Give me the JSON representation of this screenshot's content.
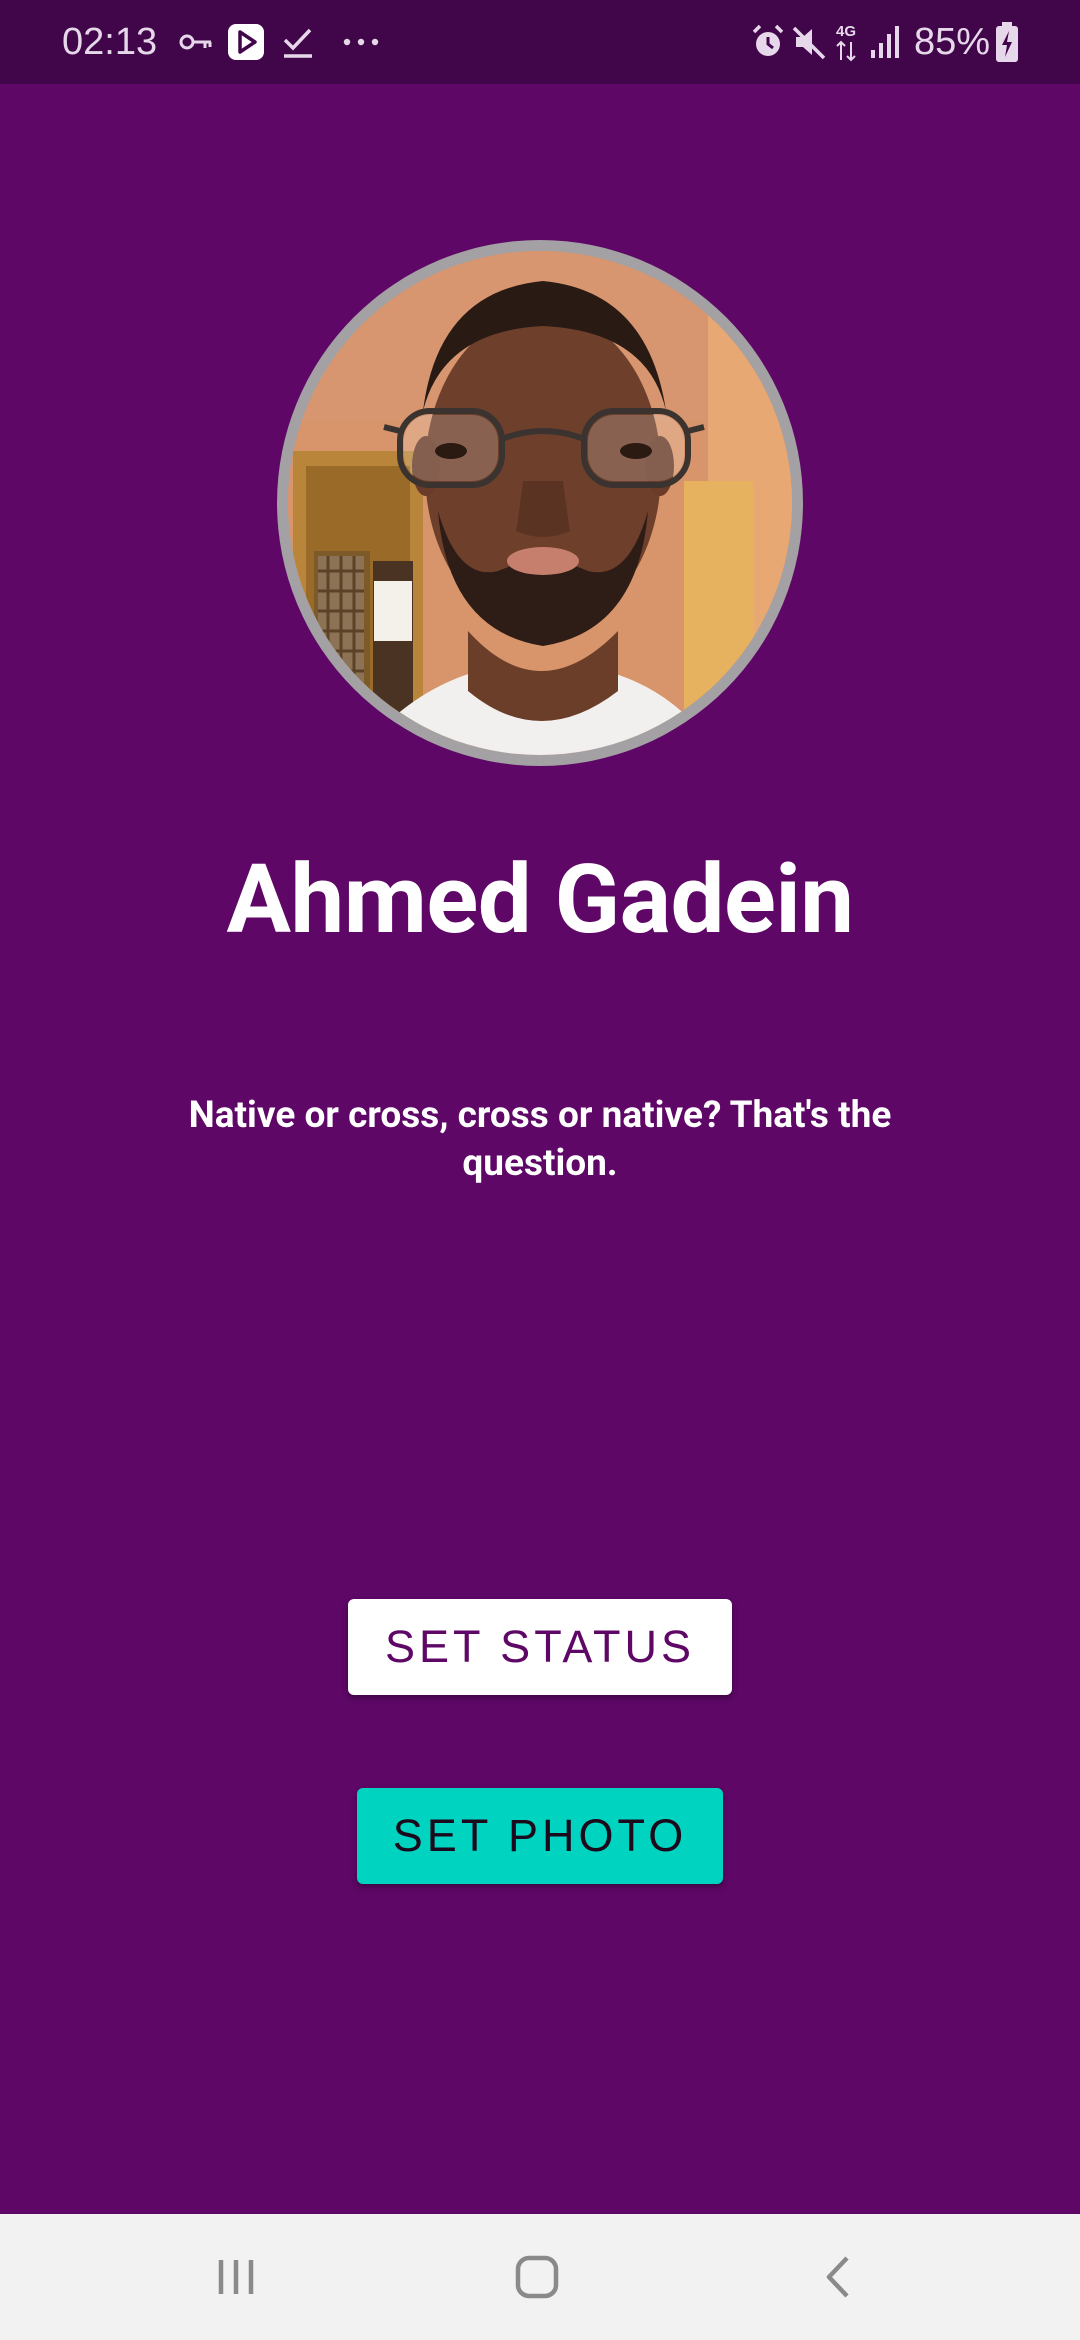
{
  "status_bar": {
    "time": "02:13",
    "battery_percent": "85%",
    "network": "4G",
    "icons": [
      "vpn-key-icon",
      "play-store-icon",
      "checkmark-icon",
      "more-dots-icon",
      "alarm-icon",
      "mute-icon",
      "network-4g-icon",
      "signal-icon",
      "battery-charging-icon"
    ]
  },
  "profile": {
    "name": "Ahmed Gadein",
    "status": "Native or cross, cross or native? That's the question."
  },
  "actions": {
    "set_status_label": "SET STATUS",
    "set_photo_label": "SET PHOTO"
  },
  "nav_bar": {
    "icons": [
      "recents-icon",
      "home-icon",
      "back-icon"
    ]
  },
  "colors": {
    "background": "#5e0766",
    "status_bar": "#41064a",
    "set_status_button": "#ffffff",
    "set_photo_button": "#00d4c0",
    "nav_bar": "#f2f2f2"
  }
}
